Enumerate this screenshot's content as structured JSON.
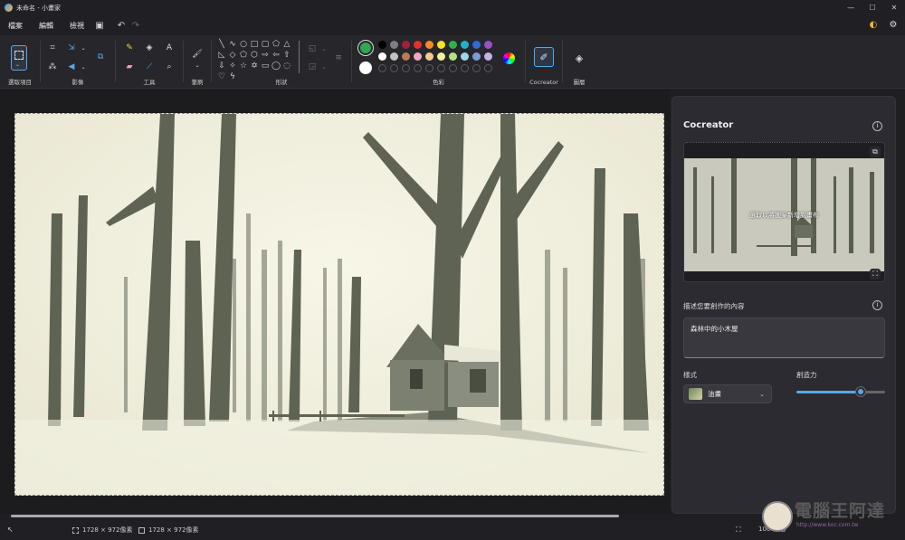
{
  "window": {
    "title": "未命名 - 小畫家",
    "controls": [
      "—",
      "☐",
      "✕"
    ]
  },
  "menu": {
    "file": "檔案",
    "edit": "編輯",
    "view": "檢視"
  },
  "ribbon": {
    "groups": {
      "select": "選取項目",
      "image": "影像",
      "tools": "工具",
      "brushes": "筆刷",
      "shapes": "形狀",
      "colors": "色彩",
      "cocreator": "Cocreator",
      "layers": "圖層"
    },
    "primary_color": "#2fa84f",
    "secondary_color": "#ffffff",
    "palette_row1": [
      "#000000",
      "#7f7f7f",
      "#a3203a",
      "#e5312b",
      "#f68b1f",
      "#f6e51f",
      "#2fb14a",
      "#22b0c9",
      "#2f6ad6",
      "#9b4fc2"
    ],
    "palette_row2": [
      "#ffffff",
      "#c3c3c3",
      "#b97a57",
      "#f3a6c8",
      "#f7c98b",
      "#f3ef9c",
      "#b6e27e",
      "#9ad9ea",
      "#7f9bd6",
      "#c7b0e3"
    ]
  },
  "cocreator": {
    "title": "Cocreator",
    "preview_hint": "選取以將圖案新增到畫布",
    "describe_label": "描述您要創作的內容",
    "prompt": "森林中的小木屋",
    "style_label": "樣式",
    "style_value": "油畫",
    "creativity_label": "創造力",
    "creativity_level": 0.72
  },
  "status": {
    "selection_size": "1728 × 972像素",
    "canvas_size": "1728 × 972像素",
    "zoom": "100%"
  },
  "watermark": {
    "text": "電腦王阿達",
    "url": "http://www.koc.com.tw"
  }
}
